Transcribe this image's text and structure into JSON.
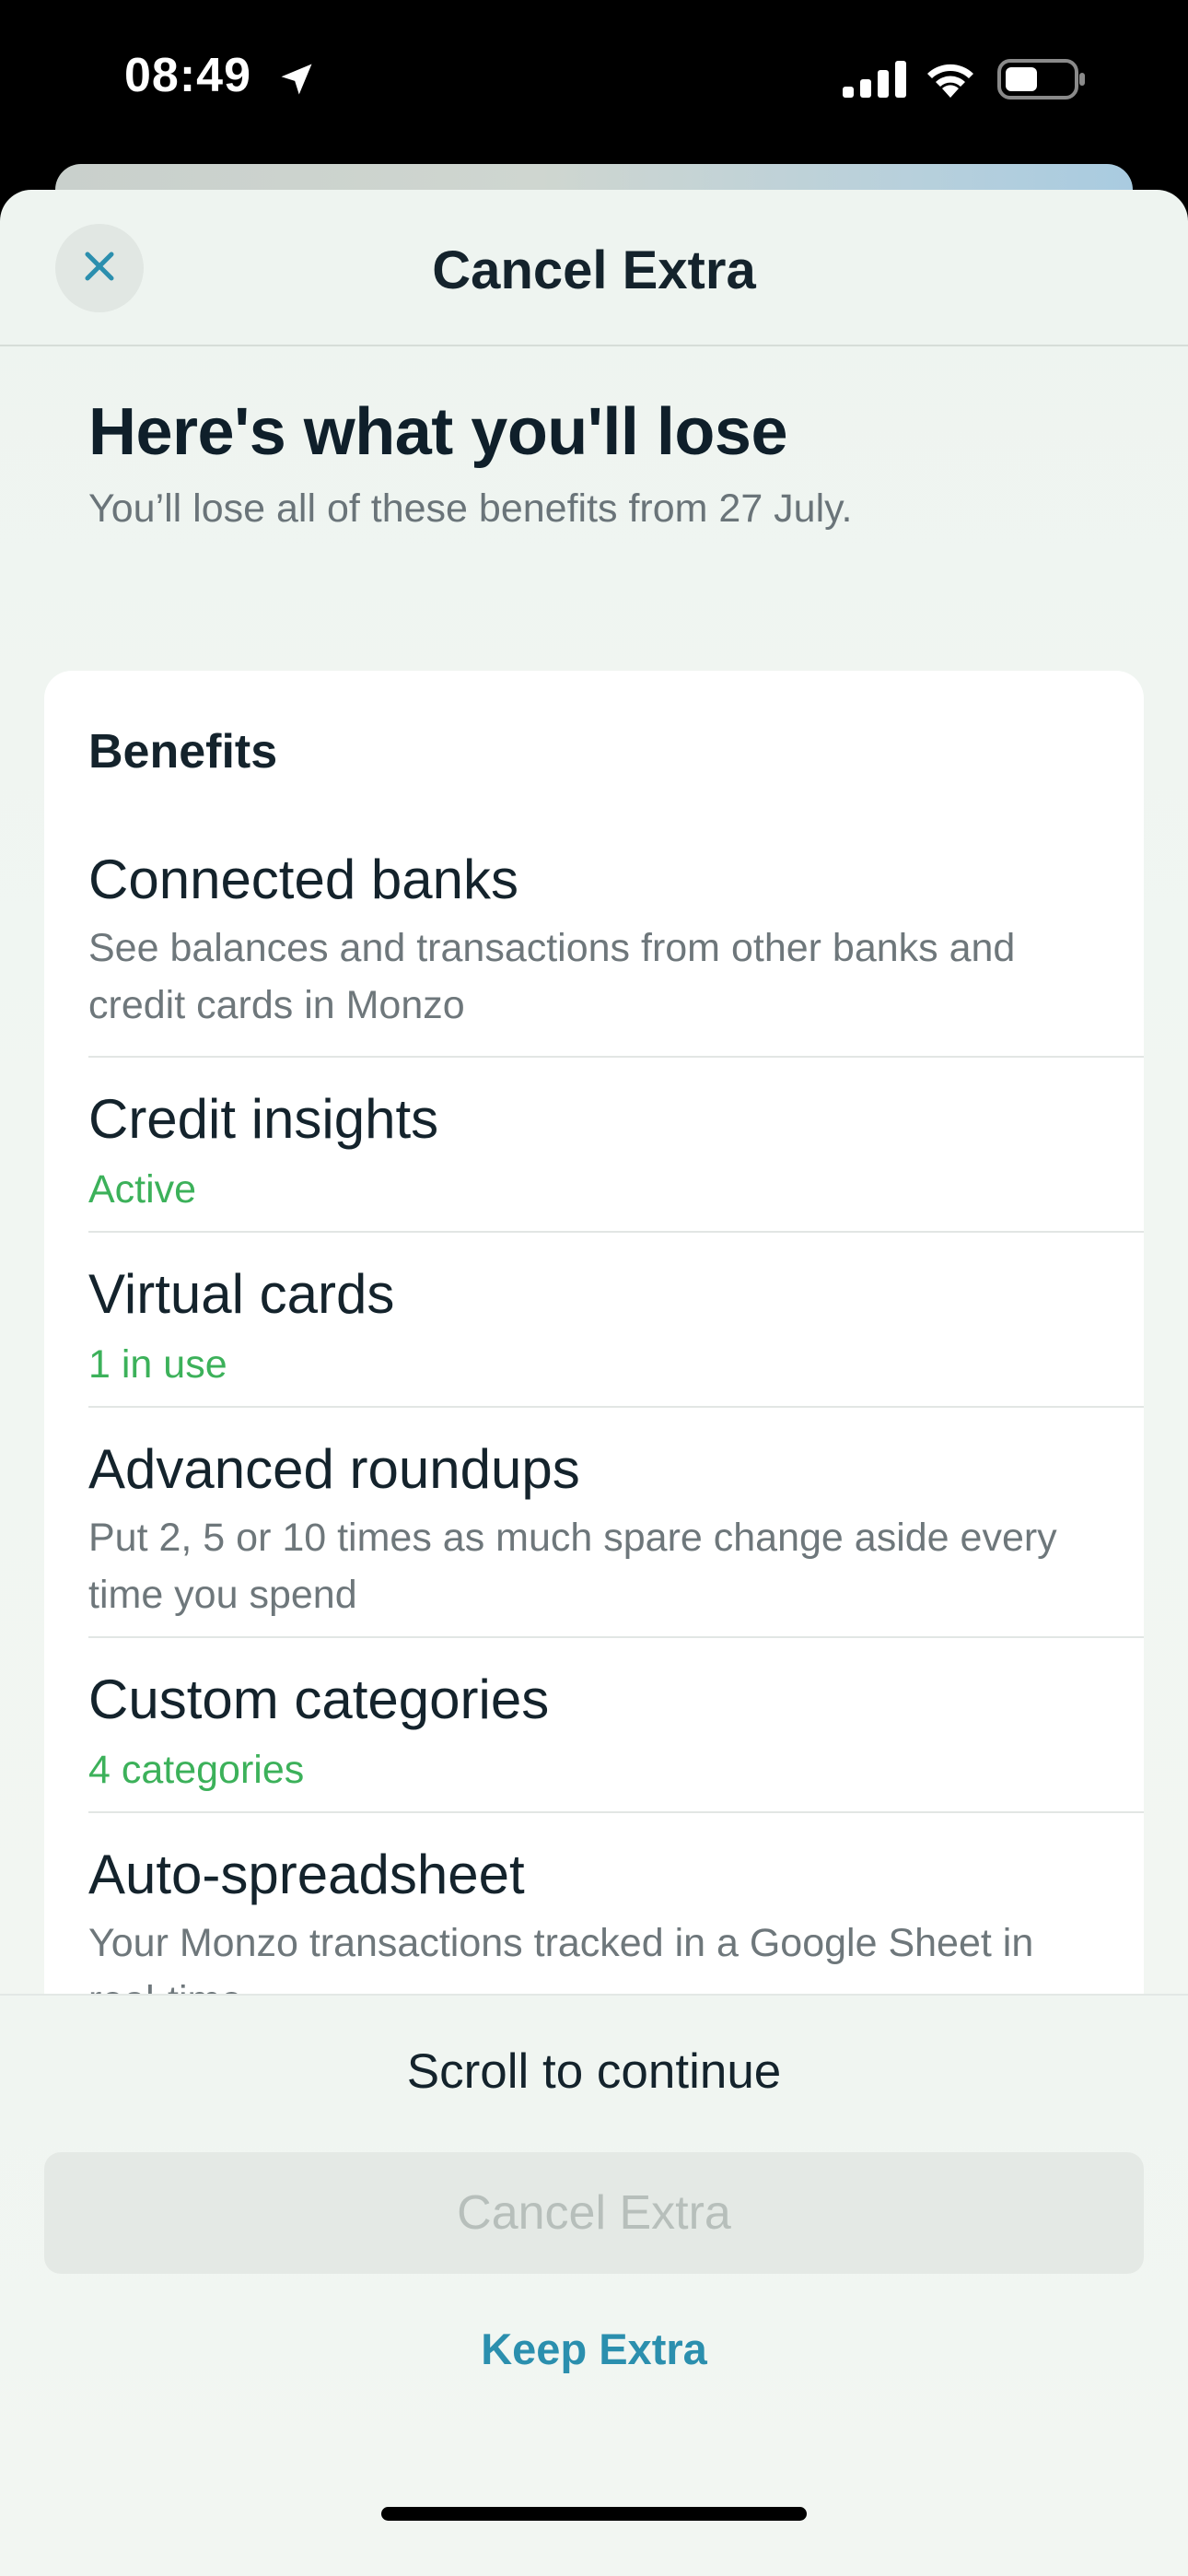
{
  "status_bar": {
    "time": "08:49",
    "icons": [
      "location-arrow-icon",
      "cellular-signal-icon",
      "wifi-icon",
      "battery-icon"
    ]
  },
  "header": {
    "title": "Cancel Extra",
    "close_icon": "close-icon"
  },
  "intro": {
    "heading": "Here's what you'll lose",
    "subheading": "You’ll lose all of these benefits from 27 July."
  },
  "benefits": {
    "title": "Benefits",
    "items": [
      {
        "title": "Connected banks",
        "description": "See balances and transactions from other banks and credit cards in Monzo",
        "status": false
      },
      {
        "title": "Credit insights",
        "description": "Active",
        "status": true
      },
      {
        "title": "Virtual cards",
        "description": "1 in use",
        "status": true
      },
      {
        "title": "Advanced roundups",
        "description": "Put 2, 5 or 10 times as much spare change aside every time you spend",
        "status": false
      },
      {
        "title": "Custom categories",
        "description": "4 categories",
        "status": true
      },
      {
        "title": "Auto-spreadsheet",
        "description": "Your Monzo transactions tracked in a Google Sheet in real-time",
        "status": false
      }
    ]
  },
  "footer": {
    "scroll_hint": "Scroll to continue",
    "cancel_label": "Cancel Extra",
    "keep_label": "Keep Extra"
  },
  "colors": {
    "status_green": "#3cb15a",
    "link_blue": "#2b8fae",
    "close_blue": "#2b8fae"
  }
}
